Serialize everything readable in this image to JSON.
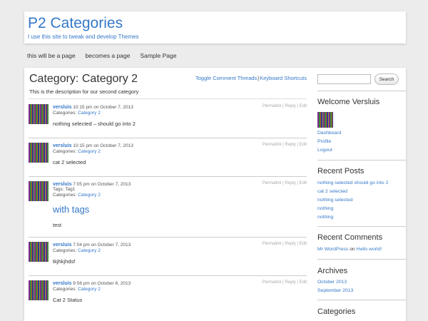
{
  "site": {
    "title": "P2 Categories",
    "description": "I use this site to tweak and develop Themes"
  },
  "nav": [
    "this will be a page",
    "becomes a page",
    "Sample Page"
  ],
  "category": {
    "title": "Category: Category 2",
    "description": "This is the description for our second category",
    "toggle_label": "Toggle Comment Threads",
    "separator": "|",
    "shortcuts_label": "Keyboard Shortcuts"
  },
  "post_actions": {
    "permalink": "Permalink",
    "reply": "Reply",
    "edit": "Edit",
    "sep": " | "
  },
  "categories_label": "Categories:",
  "tags_label": "Tags:",
  "posts": [
    {
      "author": "versluis",
      "time": "10:15 pm",
      "on": "on",
      "date": "October 7, 2013",
      "category": "Category 2",
      "body": "nothing selected – should go into 2"
    },
    {
      "author": "versluis",
      "time": "10:15 pm",
      "on": "on",
      "date": "October 7, 2013",
      "category": "Category 2",
      "body": "cat 2 selected"
    },
    {
      "author": "versluis",
      "time": "7:05 pm",
      "on": "on",
      "date": "October 7, 2013",
      "tags": "Tag1",
      "category": "Category 2",
      "heading": "with tags",
      "body": "test"
    },
    {
      "author": "versluis",
      "time": "7:04 pm",
      "on": "on",
      "date": "October 7, 2013",
      "category": "Category 2",
      "body": "tkjhkjhdsf"
    },
    {
      "author": "versluis",
      "time": "9:56 pm",
      "on": "on",
      "date": "October 6, 2013",
      "category": "Category 2",
      "body": "Cat 2 Status"
    }
  ],
  "sidebar": {
    "search_button": "Search",
    "welcome": "Welcome Versluis",
    "user_links": [
      "Dashboard",
      "Profile",
      "Logout"
    ],
    "recent_posts_title": "Recent Posts",
    "recent_posts": [
      "nothing selected should go into 2",
      "cat 2 selected",
      "nothing selected",
      "nothing",
      "nothing"
    ],
    "recent_comments_title": "Recent Comments",
    "comment_author": "Mr WordPress",
    "comment_on": "on",
    "comment_post": "Hello world!",
    "archives_title": "Archives",
    "archives": [
      "October 2013",
      "September 2013"
    ],
    "categories_title": "Categories"
  },
  "colors": {
    "link": "#3478c8",
    "background": "#ececec",
    "panel": "#ffffff"
  }
}
